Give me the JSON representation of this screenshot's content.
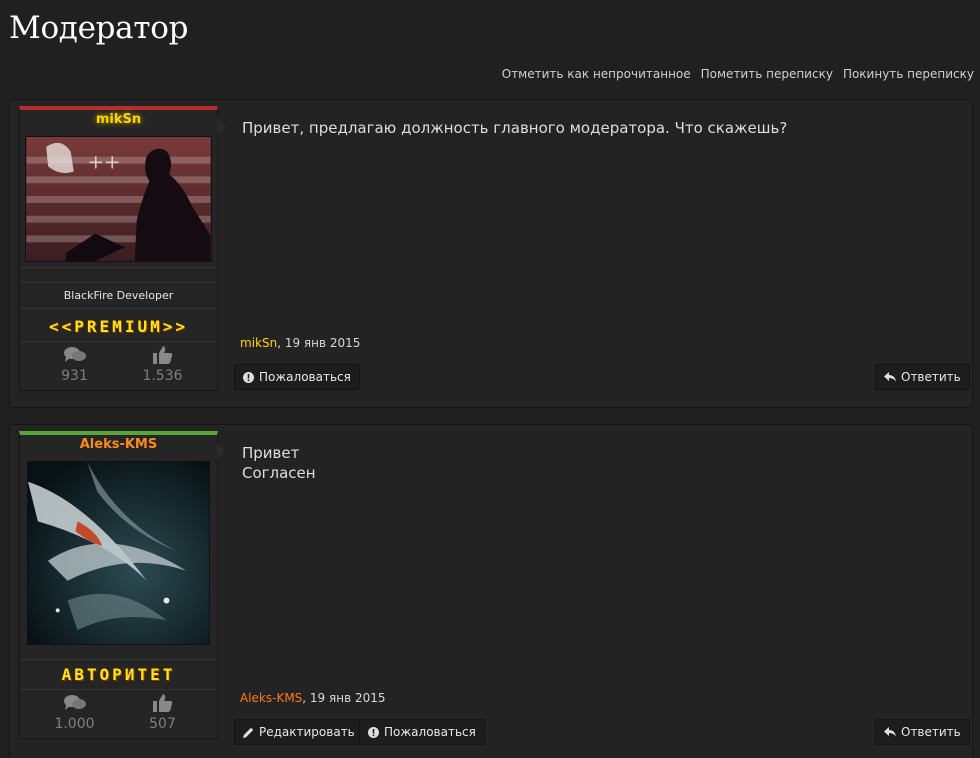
{
  "page": {
    "title": "Модератор"
  },
  "actions": {
    "mark_unread": "Отметить как непрочитанное",
    "mark_conversation": "Пометить переписку",
    "leave_conversation": "Покинуть переписку"
  },
  "posts": [
    {
      "username": "mikSn",
      "user_title": "BlackFire Developer",
      "badge": "<<PREMIUM>>",
      "stats": {
        "messages": "931",
        "likes": "1.536"
      },
      "message_lines": [
        "Привет, предлагаю должность главного модератора. Что скажешь?"
      ],
      "date": ", 19 янв 2015",
      "buttons": {
        "report": "Пожаловаться",
        "reply": "Ответить"
      },
      "accent_color": "#b52e2e"
    },
    {
      "username": "Aleks-KMS",
      "badge": "АВТОРИТЕТ",
      "stats": {
        "messages": "1.000",
        "likes": "507"
      },
      "message_lines": [
        "Привет",
        "Согласен"
      ],
      "date": ", 19 янв 2015",
      "buttons": {
        "edit": "Редактировать",
        "report": "Пожаловаться",
        "reply": "Ответить"
      },
      "accent_color": "#58a637"
    }
  ]
}
